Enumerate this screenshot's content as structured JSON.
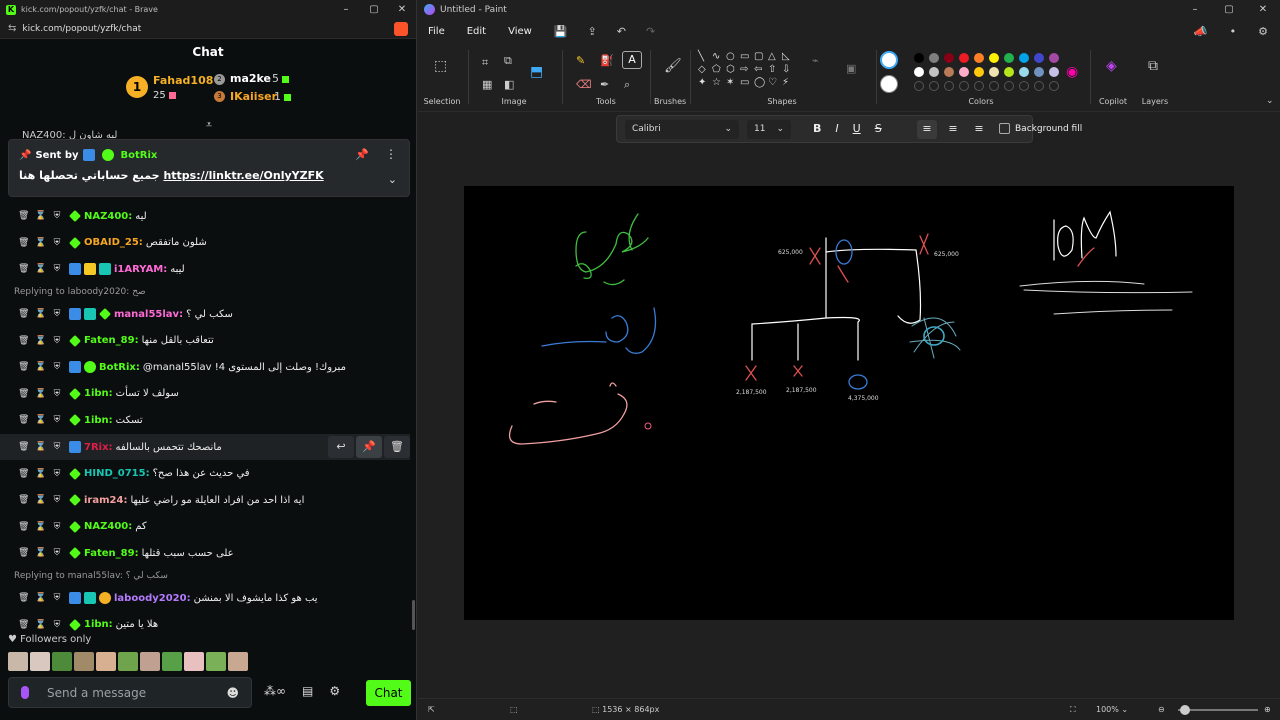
{
  "browser": {
    "title": "kick.com/popout/yzfk/chat - Brave",
    "url": "kick.com/popout/yzfk/chat",
    "logo": "K"
  },
  "chat": {
    "heading": "Chat",
    "leaderboard": [
      {
        "rank": "1",
        "name": "Fahad108",
        "count": "25"
      },
      {
        "rank": "2",
        "name": "ma2ke",
        "count": "5"
      },
      {
        "rank": "3",
        "name": "IKaiiser",
        "count": "1"
      }
    ],
    "ghost_text": "NAZ400: لبه شاون ل",
    "pinned": {
      "sent_by": "Sent by",
      "bot": "BotRix",
      "text": "جميع حساباتي تحصلها هنا",
      "link": "https://linktr.ee/OnlyYZFK"
    },
    "messages": [
      {
        "user": "NAZ400:",
        "text": "ليه",
        "color": "#53fc18"
      },
      {
        "user": "OBAID_25:",
        "text": "شلون ماتفقص",
        "color": "#f5a623"
      },
      {
        "user": "i1ARYAM:",
        "text": "ليبه",
        "color": "#ff6ad5"
      },
      {
        "reply": "Replying to laboody2020: صح"
      },
      {
        "user": "manal55lav:",
        "text": "سكب لي ؟",
        "color": "#ff6ad5"
      },
      {
        "user": "Faten_89:",
        "text": "تتعاقب بالقل منها",
        "color": "#53fc18"
      },
      {
        "user": "BotRix:",
        "text": "@manal55lav !مبروك! وصلت إلى المستوى 4",
        "color": "#53fc18"
      },
      {
        "user": "1ibn:",
        "text": "سولف لا تسأت",
        "color": "#53fc18"
      },
      {
        "user": "1ibn:",
        "text": "تسكت",
        "color": "#53fc18"
      },
      {
        "user": "7Rix:",
        "text": "مانصحك تتحمس بالسالفه",
        "color": "#e11d48"
      },
      {
        "user": "HIND_0715:",
        "text": "في حديث عن هذا صح؟",
        "color": "#19c6b4"
      },
      {
        "user": "iram24:",
        "text": "ايه اذا احد من افراد العايلة مو راضي عليها",
        "color": "#f5a0a0"
      },
      {
        "user": "NAZ400:",
        "text": "كم",
        "color": "#53fc18"
      },
      {
        "user": "Faten_89:",
        "text": "على حسب سبب قتلها",
        "color": "#53fc18"
      },
      {
        "reply": "Replying to manal55lav: سكب لي ؟"
      },
      {
        "user": "laboody2020:",
        "text": "يب هو كذا مايشوف الا بمنشن",
        "color": "#b57bff"
      },
      {
        "user": "1ibn:",
        "text": "هلا يا متين",
        "color": "#53fc18"
      }
    ],
    "followers_only": "Followers only",
    "composer_placeholder": "Send a message",
    "send_label": "Chat"
  },
  "paint": {
    "title": "Untitled - Paint",
    "menu": [
      "File",
      "Edit",
      "View"
    ],
    "groups": {
      "selection": "Selection",
      "image": "Image",
      "tools": "Tools",
      "brushes": "Brushes",
      "shapes": "Shapes",
      "colors": "Colors",
      "copilot": "Copilot",
      "layers": "Layers"
    },
    "font": "Calibri",
    "font_size": "11",
    "background_fill": "Background fill",
    "canvas_size": "1536 × 864px",
    "zoom": "100%",
    "canvas_text": {
      "v1": "625,000",
      "v2": "625,000",
      "v3": "2,187,500",
      "v4": "2,187,500",
      "v5": "4,375,000"
    }
  },
  "colors": {
    "kick_green": "#53fc18",
    "palette_row1": [
      "#000000",
      "#7f7f7f",
      "#880015",
      "#ed1c24",
      "#ff7f27",
      "#fff200",
      "#22b14c",
      "#00a2e8",
      "#3f48cc",
      "#a349a4"
    ],
    "palette_row2": [
      "#ffffff",
      "#c3c3c3",
      "#b97a57",
      "#ffaec9",
      "#ffc90e",
      "#efe4b0",
      "#b5e61d",
      "#99d9ea",
      "#7092be",
      "#c8bfe7"
    ]
  }
}
